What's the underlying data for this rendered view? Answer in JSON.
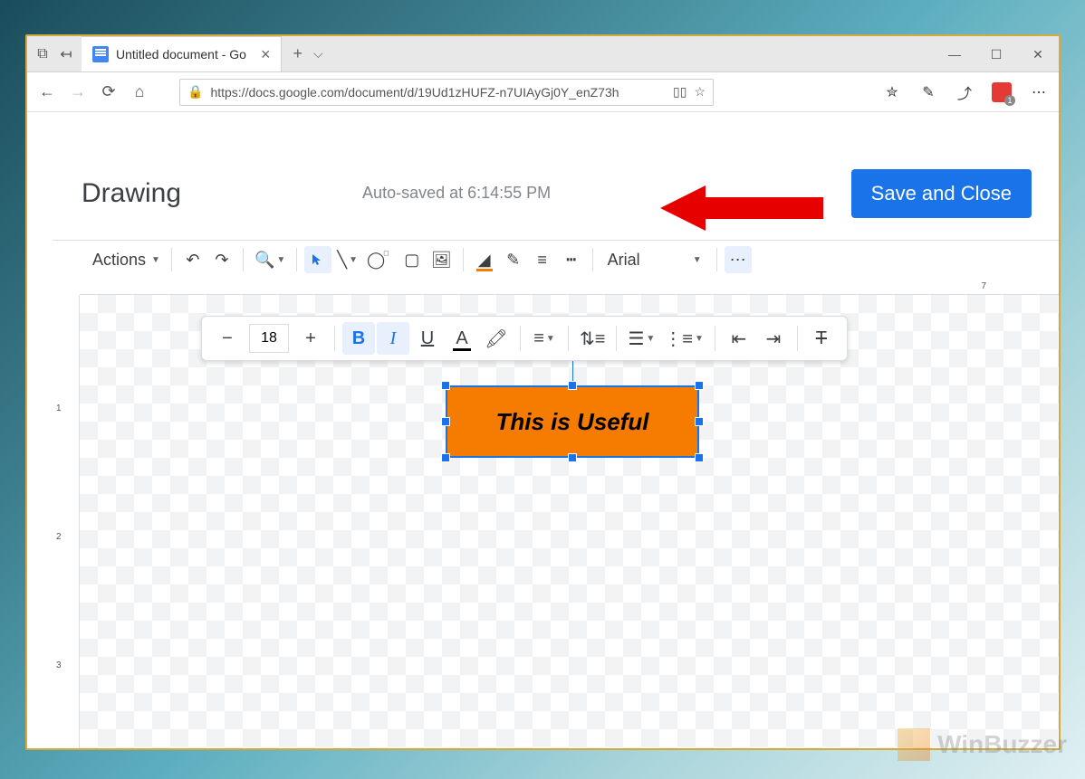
{
  "browser": {
    "tab_title": "Untitled document - Go",
    "url": "https://docs.google.com/document/d/19Ud1zHUFZ-n7UIAyGj0Y_enZ73h"
  },
  "dialog": {
    "title": "Drawing",
    "autosave": "Auto-saved at 6:14:55 PM",
    "save_button": "Save and Close"
  },
  "toolbar": {
    "actions": "Actions",
    "font": "Arial"
  },
  "text_toolbar": {
    "font_size": "18"
  },
  "textbox": {
    "content": "This is Useful"
  },
  "ruler_h": {
    "marks": [
      "7"
    ]
  },
  "ruler_v": {
    "marks": [
      "1",
      "2",
      "3"
    ]
  },
  "watermark": "WinBuzzer"
}
